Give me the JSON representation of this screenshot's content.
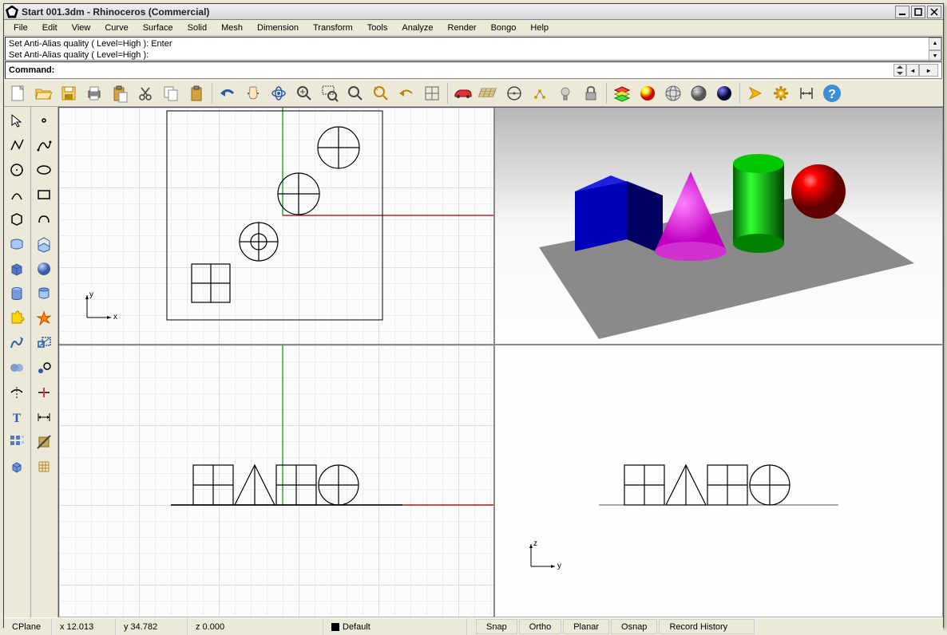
{
  "window": {
    "title": "Start 001.3dm - Rhinoceros (Commercial)"
  },
  "menu": [
    "File",
    "Edit",
    "View",
    "Curve",
    "Surface",
    "Solid",
    "Mesh",
    "Dimension",
    "Transform",
    "Tools",
    "Analyze",
    "Render",
    "Bongo",
    "Help"
  ],
  "cmd_history": {
    "line1": "Set Anti-Alias quality ( Level=High ): Enter",
    "line2": "Set Anti-Alias quality ( Level=High ):"
  },
  "cmd_prompt": "Command:",
  "toolbar_main": {
    "icons": [
      "new-file",
      "open-file",
      "save-file",
      "print",
      "clipboard-paste",
      "cut",
      "copy",
      "paste",
      "undo",
      "redo",
      "pan",
      "rotate-view",
      "zoom-extents",
      "zoom-window",
      "zoom-selected",
      "zoom-previous",
      "zoom-1to1",
      "4-view",
      "car-model",
      "grid-options",
      "circle-osnap",
      "osnap-points",
      "light",
      "lock",
      "layers",
      "material-sphere",
      "wireframe-sphere",
      "shaded-sphere",
      "rendered-sphere",
      "options-arrow",
      "gear",
      "dimension-link",
      "help"
    ]
  },
  "side_toolbar_a": {
    "icons_left": [
      "pointer",
      "polyline",
      "circle",
      "arc",
      "hexagon",
      "surface-patch",
      "box",
      "cylinder",
      "puzzle",
      "drag-curve",
      "blend",
      "sphere-small",
      "trim",
      "text",
      "array",
      "cube-small"
    ],
    "icons_right": [
      "point",
      "curve",
      "ellipse",
      "rectangle",
      "freeform",
      "extrude",
      "sphere",
      "pipe",
      "explode",
      "flash",
      "scale",
      "dot",
      "split",
      "dimension",
      "clip",
      "mesh-grid"
    ]
  },
  "viewports": {
    "top_left": {
      "axis_x": "x",
      "axis_y": "y"
    },
    "bottom_right": {
      "axis_x": "y",
      "axis_y": "z"
    }
  },
  "statusbar": {
    "cplane": "CPlane",
    "x": "x 12.013",
    "y": "y 34.782",
    "z": "z 0.000",
    "layer": "Default",
    "buttons": [
      "Snap",
      "Ortho",
      "Planar",
      "Osnap",
      "Record History"
    ]
  }
}
